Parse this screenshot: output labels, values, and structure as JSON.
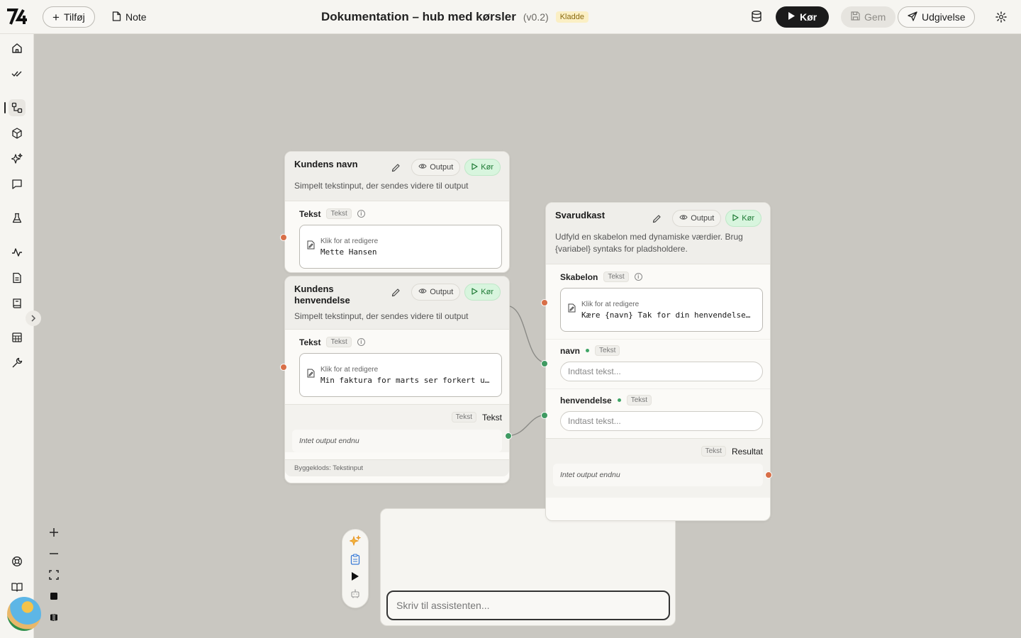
{
  "topbar": {
    "logo": "7⁄₄",
    "add_label": "Tilføj",
    "note_label": "Note",
    "title": "Dokumentation – hub med kørsler",
    "version": "(v0.2)",
    "status_badge": "Kladde",
    "run_label": "Kør",
    "save_label": "Gem",
    "publish_label": "Udgivelse"
  },
  "sidebar": {
    "icons": [
      "home-icon",
      "check-icon",
      "flow-icon",
      "cube-icon",
      "sparkles-icon",
      "chat-icon",
      "flask-icon",
      "activity-icon",
      "document-icon",
      "book-icon",
      "table-icon",
      "wrench-icon",
      "lifebuoy-icon",
      "open-book-icon"
    ],
    "active": "flow-icon"
  },
  "nodes": {
    "name": {
      "title": "Kundens navn",
      "output_label": "Output",
      "run_label": "Kør",
      "description": "Simpelt tekstinput, der sendes videre til output",
      "field_label": "Tekst",
      "field_type": "Tekst",
      "hint": "Klik for at redigere",
      "value": "Mette Hansen"
    },
    "inquiry": {
      "title": "Kundens henvendelse",
      "output_label": "Output",
      "run_label": "Kør",
      "description": "Simpelt tekstinput, der sendes videre til output",
      "field_label": "Tekst",
      "field_type": "Tekst",
      "hint": "Klik for at redigere",
      "value": "Min faktura for marts ser forkert u…",
      "output_type": "Tekst",
      "output_name": "Tekst",
      "no_output": "Intet output endnu",
      "footer": "Byggeklods: Tekstinput"
    },
    "draft": {
      "title": "Svarudkast",
      "output_label": "Output",
      "run_label": "Kør",
      "description": "Udfyld en skabelon med dynamiske værdier. Brug {variabel} syntaks for pladsholdere.",
      "template_label": "Skabelon",
      "template_type": "Tekst",
      "hint": "Klik for at redigere",
      "template_value": "Kære {navn} Tak for din henvendelse…",
      "var1_label": "navn",
      "var1_type": "Tekst",
      "var1_placeholder": "Indtast tekst...",
      "var2_label": "henvendelse",
      "var2_type": "Tekst",
      "var2_placeholder": "Indtast tekst...",
      "output_type": "Tekst",
      "output_name": "Resultat",
      "no_output": "Intet output endnu"
    }
  },
  "assistant": {
    "placeholder": "Skriv til assistenten..."
  },
  "colors": {
    "accent_dark": "#1b1b1b",
    "run_green": "#1e7a35",
    "port_orange": "#d86f48",
    "port_green": "#3f9a62",
    "draft_badge": "#fbefc4"
  }
}
